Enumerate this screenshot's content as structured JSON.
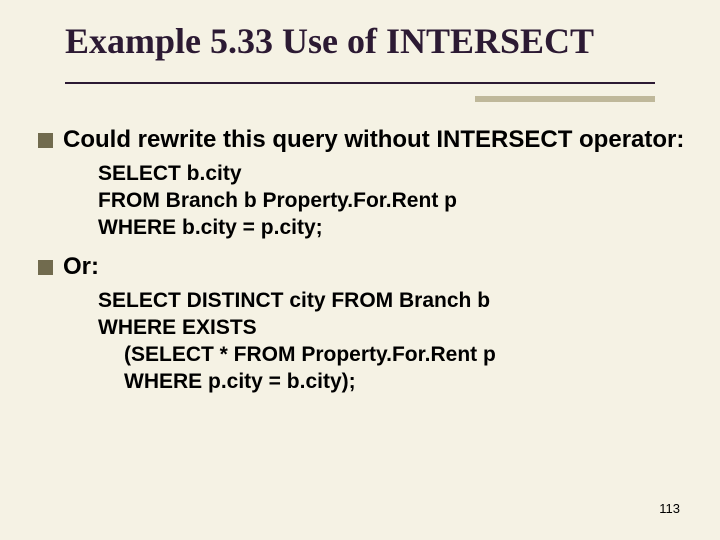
{
  "title": "Example 5.33  Use of INTERSECT",
  "bullets": [
    {
      "text": "Could rewrite this query without INTERSECT operator:",
      "code": [
        {
          "t": "SELECT b.city",
          "indent": false
        },
        {
          "t": "FROM Branch b Property.For.Rent p",
          "indent": false
        },
        {
          "t": "WHERE b.city = p.city;",
          "indent": false
        }
      ]
    },
    {
      "text": "Or:",
      "code": [
        {
          "t": "SELECT DISTINCT city FROM Branch b",
          "indent": false
        },
        {
          "t": "WHERE EXISTS",
          "indent": false
        },
        {
          "t": "(SELECT * FROM Property.For.Rent p",
          "indent": true
        },
        {
          "t": "WHERE p.city = b.city);",
          "indent": true
        }
      ]
    }
  ],
  "page_number": "113"
}
